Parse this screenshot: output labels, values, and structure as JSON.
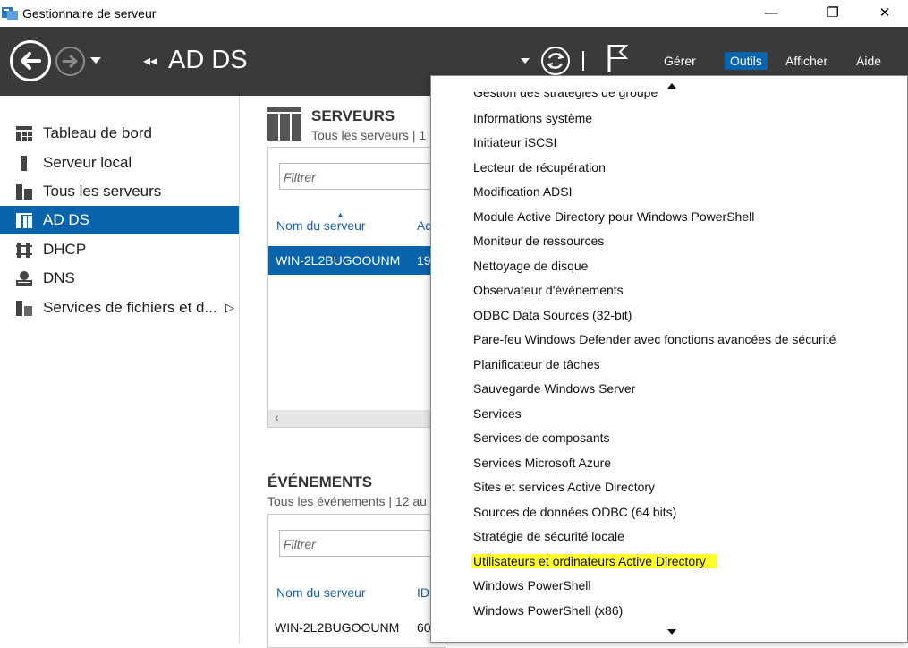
{
  "window": {
    "title": "Gestionnaire de serveur",
    "minimize": "—",
    "restore": "❐",
    "close": "✕"
  },
  "toolbar": {
    "breadcrumb_arrows": "◂◂",
    "breadcrumb": "AD DS",
    "menus": [
      "Gérer",
      "Outils",
      "Afficher",
      "Aide"
    ],
    "active_menu": "Outils"
  },
  "sidebar": {
    "items": [
      {
        "label": "Tableau de bord",
        "icon": "dashboard-icon"
      },
      {
        "label": "Serveur local",
        "icon": "local-server-icon"
      },
      {
        "label": "Tous les serveurs",
        "icon": "all-servers-icon"
      },
      {
        "label": "AD DS",
        "icon": "adds-icon",
        "active": true
      },
      {
        "label": "DHCP",
        "icon": "dhcp-icon"
      },
      {
        "label": "DNS",
        "icon": "dns-icon"
      },
      {
        "label": "Services de fichiers et d...",
        "icon": "file-services-icon",
        "chevron": "▷"
      }
    ]
  },
  "servers": {
    "title": "SERVEURS",
    "subtitle": "Tous les serveurs | 1",
    "filter_placeholder": "Filtrer",
    "col_name": "Nom du serveur",
    "col_addr": "Ad",
    "row_name": "WIN-2L2BUGOOUNM",
    "row_addr": "19",
    "scroll_left": "‹"
  },
  "events": {
    "title": "ÉVÉNEMENTS",
    "subtitle": "Tous les événements | 12 au",
    "filter_placeholder": "Filtrer",
    "col_name": "Nom du serveur",
    "col_id": "ID",
    "row_name": "WIN-2L2BUGOOUNM",
    "row_id": "60"
  },
  "tools_menu": {
    "items": [
      "Gestion des stratégies de groupe",
      "Informations système",
      "Initiateur iSCSI",
      "Lecteur de récupération",
      "Modification ADSI",
      "Module Active Directory pour Windows PowerShell",
      "Moniteur de ressources",
      "Nettoyage de disque",
      "Observateur d'événements",
      "ODBC Data Sources (32-bit)",
      "Pare-feu Windows Defender avec fonctions avancées de sécurité",
      "Planificateur de tâches",
      "Sauvegarde Windows Server",
      "Services",
      "Services de composants",
      "Services Microsoft Azure",
      "Sites et services Active Directory",
      "Sources de données ODBC (64 bits)",
      "Stratégie de sécurité locale",
      "Utilisateurs et ordinateurs Active Directory",
      "Windows PowerShell",
      "Windows PowerShell (x86)"
    ],
    "highlighted": "Utilisateurs et ordinateurs Active Directory",
    "highlight_color": "#ffff2e"
  },
  "colors": {
    "accent": "#0a64ad",
    "topbar": "#3a3a3a"
  }
}
